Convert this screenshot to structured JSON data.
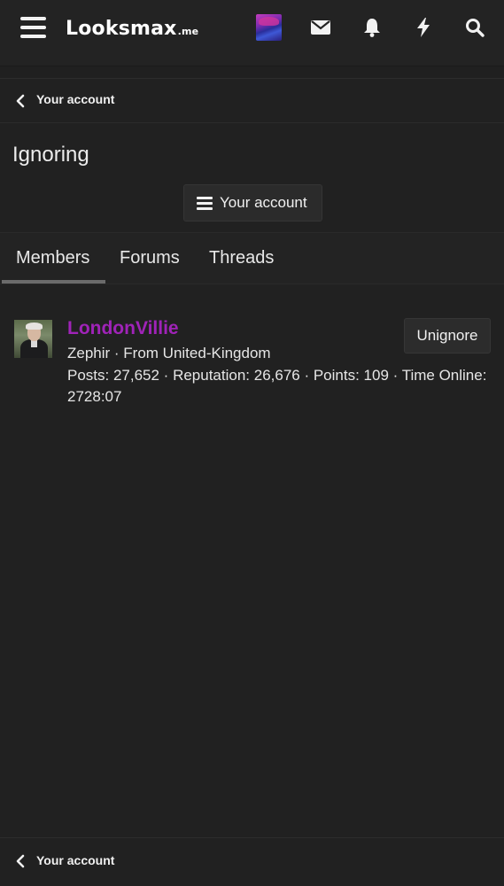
{
  "header": {
    "logo_main": "Lo",
    "logo_oo": "o",
    "logo_rest": "ksmax",
    "logo_suffix": ".me",
    "icons": [
      "menu-icon",
      "user-avatar",
      "envelope-icon",
      "bell-icon",
      "bolt-icon",
      "search-icon"
    ]
  },
  "breadcrumb": {
    "label": "Your account"
  },
  "page": {
    "title": "Ignoring",
    "account_menu_label": "Your account"
  },
  "tabs": [
    {
      "label": "Members",
      "active": true
    },
    {
      "label": "Forums",
      "active": false
    },
    {
      "label": "Threads",
      "active": false
    }
  ],
  "members": [
    {
      "name": "LondonVillie",
      "name_color": "#a023b8",
      "subtitle": "Zephir · From United-Kingdom",
      "stats": "Posts: 27,652 · Reputation: 26,676 · Points: 109 · Time Online: 2728:07",
      "action_label": "Unignore"
    }
  ],
  "footer_breadcrumb": {
    "label": "Your account"
  },
  "colors": {
    "background": "#212121",
    "header": "#232323",
    "username_accent": "#a023b8"
  }
}
